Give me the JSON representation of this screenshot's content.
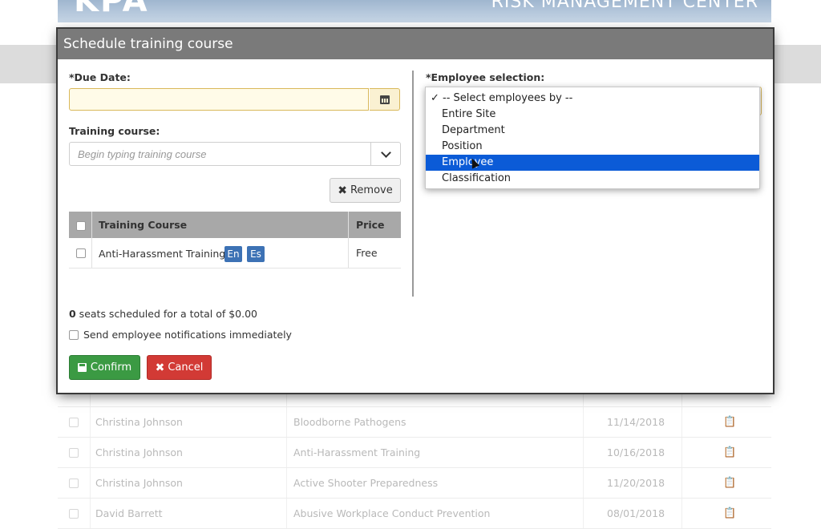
{
  "background": {
    "logo_text": "KPA",
    "title_text": "RISK MANAGEMENT CENTER",
    "rows": [
      {
        "name": "",
        "course": "",
        "date": ""
      },
      {
        "name": "Christina Johnson",
        "course": "Bloodborne Pathogens",
        "date": "11/14/2018"
      },
      {
        "name": "Christina Johnson",
        "course": "Anti-Harassment Training",
        "date": "10/16/2018"
      },
      {
        "name": "Christina Johnson",
        "course": "Active Shooter Preparedness",
        "date": "11/20/2018"
      },
      {
        "name": "David Barrett",
        "course": "Abusive Workplace Conduct Prevention",
        "date": "08/01/2018"
      }
    ]
  },
  "modal": {
    "title": "Schedule training course",
    "due_date_label": "*Due Date:",
    "due_date_value": "",
    "training_course_label": "Training course:",
    "training_course_placeholder": "Begin typing training course",
    "remove_label": "Remove",
    "table": {
      "headers": [
        "Training Course",
        "Price"
      ],
      "rows": [
        {
          "course": "Anti-Harassment Training",
          "tags": [
            "En",
            "Es"
          ],
          "price": "Free"
        }
      ]
    },
    "seats_count": "0",
    "seats_text": " seats scheduled for a total of $0.00",
    "notify_label": "Send employee notifications immediately",
    "confirm_label": "Confirm",
    "cancel_label": "Cancel",
    "employee_selection_label": "*Employee selection:",
    "employee_options": [
      {
        "label": "✓ -- Select employees by --",
        "checked": true
      },
      {
        "label": "Entire Site"
      },
      {
        "label": "Department"
      },
      {
        "label": "Position"
      },
      {
        "label": "Employee",
        "highlighted": true
      },
      {
        "label": "Classification"
      }
    ]
  },
  "colors": {
    "header_bg": "#7a7a7a",
    "confirm": "#3b9a43",
    "cancel": "#d23a35",
    "tag": "#3d72b5",
    "highlight": "#0b5bd7"
  },
  "icons": [
    "calendar-icon",
    "chevron-down-icon",
    "close-icon",
    "save-icon",
    "cursor-icon"
  ]
}
